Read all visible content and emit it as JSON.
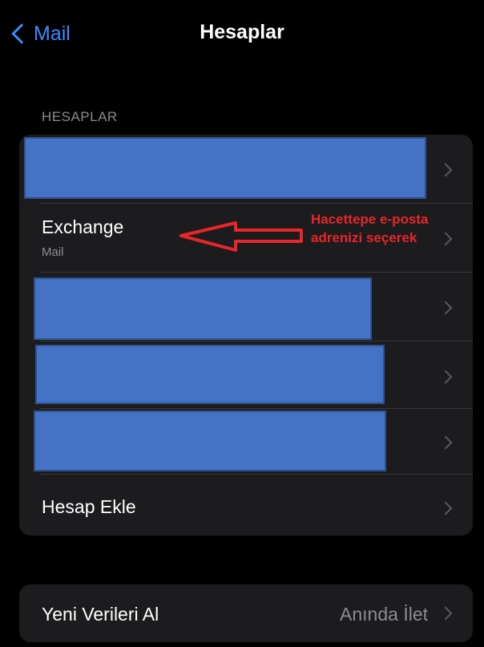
{
  "nav": {
    "back_label": "Mail",
    "title": "Hesaplar"
  },
  "accounts_section": {
    "header": "HESAPLAR",
    "rows": [
      {
        "redacted": true
      },
      {
        "title": "Exchange",
        "subtitle": "Mail"
      },
      {
        "redacted": true
      },
      {
        "redacted": true
      },
      {
        "redacted": true
      },
      {
        "title": "Hesap Ekle"
      }
    ]
  },
  "fetch_section": {
    "title": "Yeni Verileri Al",
    "value": "Anında İlet"
  },
  "annotation": {
    "line1": "Hacettepe e-posta",
    "line2": "adrenizi seçerek"
  },
  "colors": {
    "accent": "#3b8bff",
    "redaction": "#4472c4",
    "annotation": "#e8262a",
    "cell_background": "#1c1c1e"
  },
  "icons": {
    "back": "chevron-left-icon",
    "row": "chevron-right-icon",
    "annotation": "arrow-left-icon"
  }
}
